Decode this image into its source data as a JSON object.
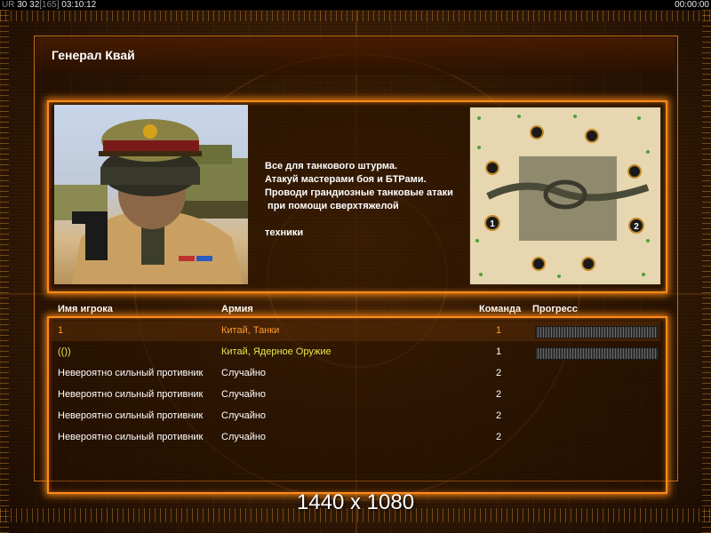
{
  "topbar": {
    "left_prefix": "UR",
    "left_a": "30",
    "left_b": "32",
    "left_c": "[165]",
    "left_time": "03:10:12",
    "right_time": "00:00:00"
  },
  "title": "Генерал Квай",
  "description": [
    "Все для танкового штурма.",
    "Атакуй мастерами боя и БТРами.",
    "Проводи грандиозные танковые атаки",
    " при помощи сверхтяжелой",
    "",
    "техники"
  ],
  "minimap": {
    "start_positions": [
      "1",
      "2"
    ]
  },
  "table": {
    "headers": {
      "player": "Имя игрока",
      "army": "Армия",
      "team": "Команда",
      "progress": "Прогресс"
    },
    "rows": [
      {
        "name": "1",
        "army": "Китай, Танки",
        "team": "1",
        "name_color": "#ff9a2e",
        "army_color": "#ff9a2e",
        "team_color": "#ff9a2e",
        "highlighted": true,
        "progress": 0
      },
      {
        "name": "(())",
        "army": "Китай, Ядерное Оружие",
        "team": "1",
        "name_color": "#e6e64a",
        "army_color": "#e6e64a",
        "team_color": "#ffffff",
        "highlighted": false,
        "progress": 0
      },
      {
        "name": "Невероятно сильный противник",
        "army": "Случайно",
        "team": "2",
        "name_color": "#ffffff",
        "army_color": "#ffffff",
        "team_color": "#ffffff",
        "highlighted": false
      },
      {
        "name": "Невероятно сильный противник",
        "army": "Случайно",
        "team": "2",
        "name_color": "#ffffff",
        "army_color": "#ffffff",
        "team_color": "#ffffff",
        "highlighted": false
      },
      {
        "name": "Невероятно сильный противник",
        "army": "Случайно",
        "team": "2",
        "name_color": "#ffffff",
        "army_color": "#ffffff",
        "team_color": "#ffffff",
        "highlighted": false
      },
      {
        "name": "Невероятно сильный противник",
        "army": "Случайно",
        "team": "2",
        "name_color": "#ffffff",
        "army_color": "#ffffff",
        "team_color": "#ffffff",
        "highlighted": false
      }
    ]
  },
  "resolution_label": "1440 x 1080",
  "colors": {
    "accent": "#ff8a1a",
    "player_orange": "#ff9a2e",
    "player_yellow": "#e6e64a"
  }
}
